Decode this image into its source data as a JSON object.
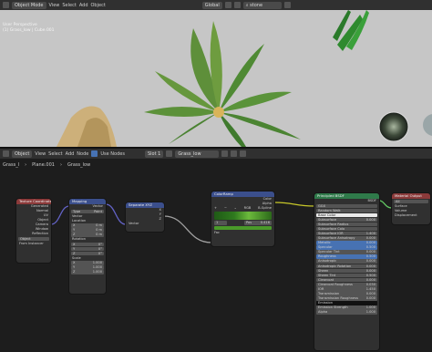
{
  "viewport": {
    "mode": "Object Mode",
    "menus": [
      "View",
      "Select",
      "Add",
      "Object"
    ],
    "transform": "Global",
    "search": "stone",
    "overlay_title": "User Perspective",
    "overlay_sub": "(1) Grass_low | Cube.001"
  },
  "node_editor": {
    "editor_type": "Object",
    "menus": [
      "View",
      "Select",
      "Add",
      "Node"
    ],
    "use_nodes": "Use Nodes",
    "slot": "Slot 1",
    "material": "Grass_low",
    "breadcrumb": [
      "Grass_l",
      "Plane.001",
      "Grass_low"
    ]
  },
  "nodes": {
    "texcoord": {
      "title": "Texture Coordinate",
      "outputs": [
        "Generated",
        "Normal",
        "UV",
        "Object",
        "Camera",
        "Window",
        "Reflection"
      ],
      "object_label": "Object",
      "from_instancer": "From Instancer"
    },
    "mapping": {
      "title": "Mapping",
      "output": "Vector",
      "type_label": "Type",
      "type_value": "Point",
      "vector": "Vector",
      "location": "Location",
      "loc": [
        "0 m",
        "0 m",
        "0 m"
      ],
      "rotation": "Rotation",
      "rot": [
        "0°",
        "0°",
        "0°"
      ],
      "scale": "Scale",
      "scl": [
        "1.000",
        "1.000",
        "1.000"
      ]
    },
    "separate": {
      "title": "Separate XYZ",
      "outputs": [
        "X",
        "Y",
        "Z"
      ],
      "input": "Vector"
    },
    "colorramp": {
      "title": "ColorRamp",
      "outputs": [
        "Color",
        "Alpha"
      ],
      "mode": "RGB",
      "interp": "B-Spline",
      "stop_index": "1",
      "stop_pos_label": "Pos",
      "stop_pos": "0.416",
      "input": "Fac"
    },
    "bsdf": {
      "title": "Principled BSDF",
      "output": "BSDF",
      "dist": "GGX",
      "sss": "Random Walk",
      "rows": [
        [
          "Base Color",
          ""
        ],
        [
          "Subsurface",
          "0.000"
        ],
        [
          "Subsurface Radius",
          ""
        ],
        [
          "Subsurface Colo",
          ""
        ],
        [
          "Subsurface IOR",
          "1.400"
        ],
        [
          "Subsurface Anisotropy",
          "0.000"
        ],
        [
          "Metallic",
          "0.000"
        ],
        [
          "Specular",
          "0.500"
        ],
        [
          "Specular Tint",
          "0.000"
        ],
        [
          "Roughness",
          "0.500"
        ],
        [
          "Anisotropic",
          "0.000"
        ],
        [
          "Anisotropic Rotation",
          "0.000"
        ],
        [
          "Sheen",
          "0.000"
        ],
        [
          "Sheen Tint",
          "0.500"
        ],
        [
          "Clearcoat",
          "0.000"
        ],
        [
          "Clearcoat Roughness",
          "0.030"
        ],
        [
          "IOR",
          "1.450"
        ],
        [
          "Transmission",
          "0.000"
        ],
        [
          "Transmission Roughness",
          "0.000"
        ],
        [
          "Emission",
          ""
        ],
        [
          "Emission Strength",
          "1.000"
        ],
        [
          "Alpha",
          "1.000"
        ]
      ]
    },
    "output": {
      "title": "Material Output",
      "target": "All",
      "inputs": [
        "Surface",
        "Volume",
        "Displacement"
      ]
    }
  }
}
